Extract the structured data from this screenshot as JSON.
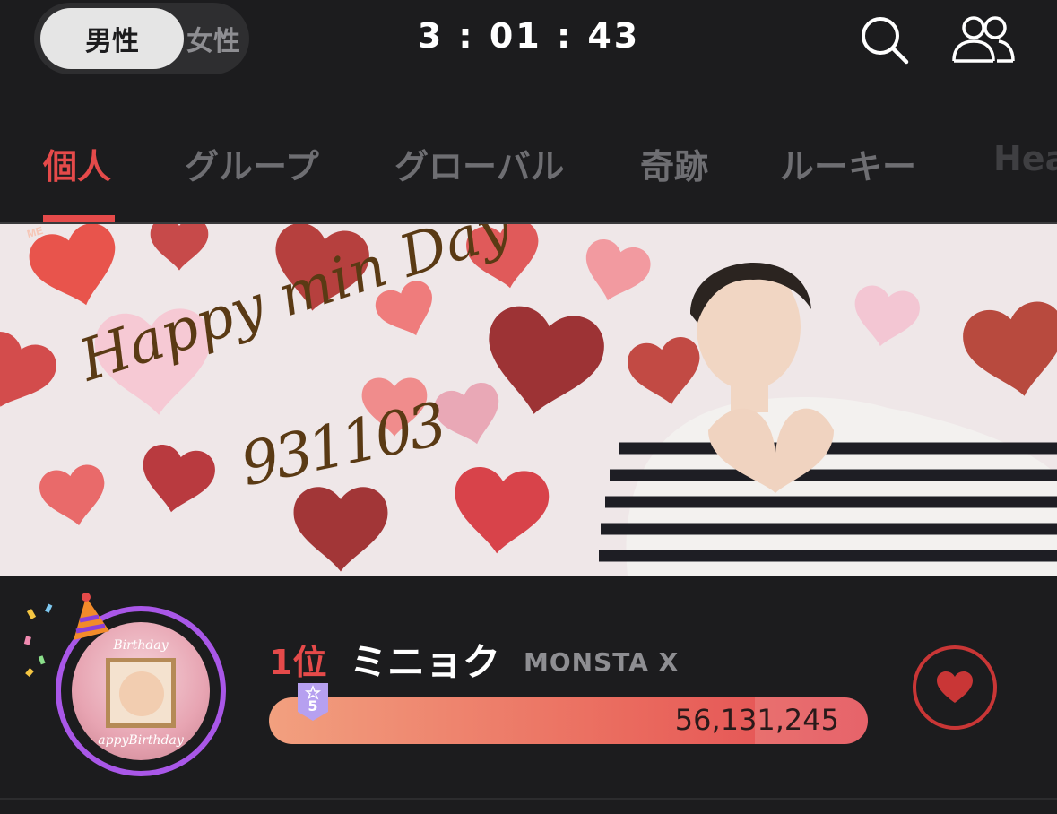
{
  "header": {
    "gender_options": [
      "男性",
      "女性"
    ],
    "active_gender": "男性",
    "timer": "3 : 01 : 43",
    "icons": [
      "search-icon",
      "people-icon"
    ]
  },
  "tabs": [
    {
      "label": "個人",
      "active": true
    },
    {
      "label": "グループ",
      "active": false
    },
    {
      "label": "グローバル",
      "active": false
    },
    {
      "label": "奇跡",
      "active": false
    },
    {
      "label": "ルーキー",
      "active": false
    },
    {
      "label": "Hea",
      "active": false
    }
  ],
  "banner": {
    "title": "Happy min Day",
    "code": "931103",
    "sticker_text": "ME"
  },
  "ranking": {
    "rank": "1位",
    "artist": "ミニョク",
    "group": "MONSTA X",
    "votes": "56,131,245",
    "level": "5",
    "avatar_text_top": "Birthday",
    "avatar_text_bottom": "appyBirthday"
  },
  "colors": {
    "accent": "#e54a4a",
    "ring": "#a957e8",
    "background": "#1c1c1e"
  }
}
